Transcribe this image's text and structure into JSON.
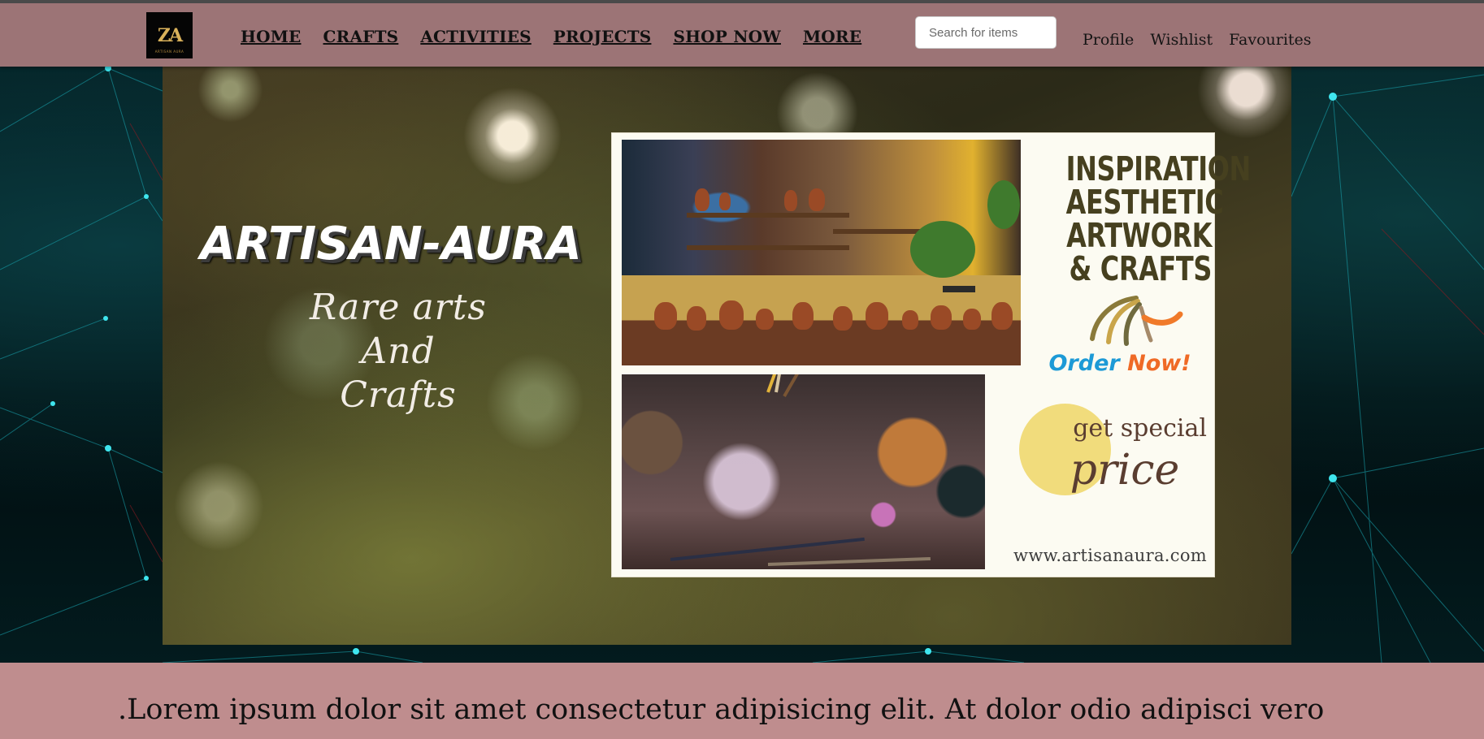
{
  "app": {
    "logo_text": "ZA",
    "logo_subtext": "ARTISAN AURA"
  },
  "nav": {
    "items": [
      {
        "label": "HOME"
      },
      {
        "label": "CRAFTS"
      },
      {
        "label": "ACTIVITIES"
      },
      {
        "label": "PROJECTS"
      },
      {
        "label": "SHOP NOW"
      },
      {
        "label": "MORE"
      }
    ]
  },
  "search": {
    "placeholder": "Search for items",
    "value": ""
  },
  "user_links": {
    "profile": "Profile",
    "wishlist": "Wishlist",
    "favourites": "Favourites"
  },
  "hero": {
    "title": "ARTISAN-AURA",
    "tagline": [
      "Rare arts",
      "And",
      "Crafts"
    ]
  },
  "poster": {
    "headline": [
      "INSPIRATION",
      "AESTHETIC",
      "ARTWORK",
      "& CRAFTS"
    ],
    "order_now_part1": "Order",
    "order_now_part2": "Now!",
    "price_line1": "get special",
    "price_line2": "price",
    "url": "www.artisanaura.com"
  },
  "description": {
    "text": ".Lorem ipsum dolor sit amet consectetur adipisicing elit. At dolor odio adipisci vero"
  },
  "colors": {
    "nav_bg": "#9c7476",
    "desc_bg": "#bf8d8e",
    "order_blue": "#1d9ad6",
    "order_orange": "#ef6a26",
    "headline": "#46401f"
  },
  "icons": [
    "logo-icon",
    "swoosh-icon"
  ]
}
